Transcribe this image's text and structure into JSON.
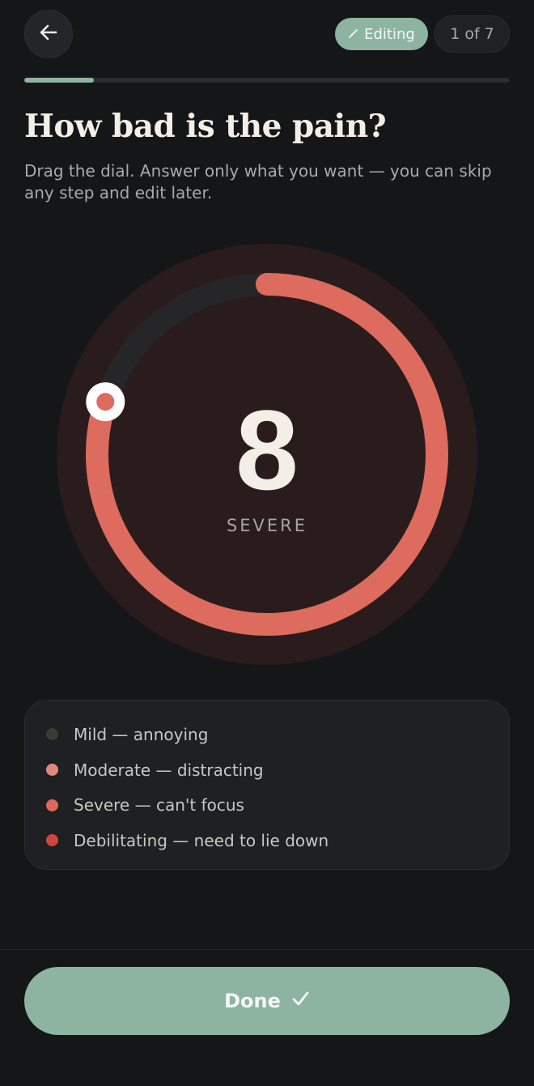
{
  "header": {
    "back_icon": "arrow-left-icon",
    "editing_icon": "pencil-icon",
    "editing_label": "Editing",
    "step_label": "1 of 7",
    "progress": 0.143
  },
  "question": {
    "title": "How bad is the pain?",
    "subtitle": "Drag the dial. Answer only what you want — you can skip any step and edit later."
  },
  "dial": {
    "value": "8",
    "max": 10,
    "level": 0.8,
    "severity_label": "SEVERE"
  },
  "legend": {
    "items": [
      {
        "label": "Mild — annoying",
        "color": "#3b3a33"
      },
      {
        "label": "Moderate — distracting",
        "color": "#e08a7c"
      },
      {
        "label": "Severe — can't focus",
        "color": "#e0665a"
      },
      {
        "label": "Debilitating — need to lie down",
        "color": "#d2453e"
      }
    ]
  },
  "footer": {
    "done_label": "Done",
    "done_icon": "checkmark-icon"
  },
  "colors": {
    "accent": "#8db4a1",
    "dial_arc": "#dd6b5e",
    "dial_bg": "#2a1c1c"
  }
}
